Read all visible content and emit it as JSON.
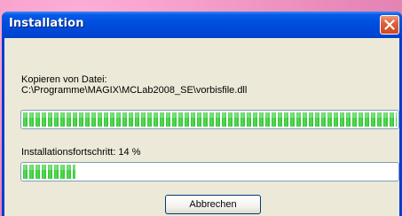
{
  "window": {
    "title": "Installation"
  },
  "dialog": {
    "copy_label": "Kopieren von Datei:",
    "file_path": "C:\\Programme\\MAGIX\\MCLab2008_SE\\vorbisfile.dll",
    "file_progress_fraction": 1.0,
    "overall_label": "Installationsfortschritt: 14 %",
    "overall_progress_fraction": 0.14,
    "cancel_label": "Abbrechen"
  },
  "colors": {
    "progress_green": "#2ec22e",
    "titlebar_blue": "#0050e0",
    "close_red": "#e0603a",
    "client_bg": "#ece9d8"
  },
  "icons": [
    "close-icon"
  ]
}
